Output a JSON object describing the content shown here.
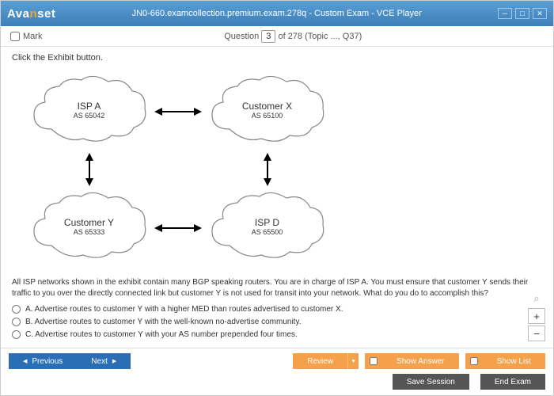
{
  "titlebar": {
    "logo_pre": "Ava",
    "logo_accent": "n",
    "logo_post": "set",
    "title": "JN0-660.examcollection.premium.exam.278q - Custom Exam - VCE Player"
  },
  "qbar": {
    "mark": "Mark",
    "qword": "Question",
    "num": "3",
    "rest": " of 278 (Topic ..., Q37)"
  },
  "instr": "Click the Exhibit button.",
  "clouds": {
    "tl": {
      "main": "ISP A",
      "sub": "AS 65042"
    },
    "tr": {
      "main": "Customer X",
      "sub": "AS 65100"
    },
    "bl": {
      "main": "Customer Y",
      "sub": "AS 65333"
    },
    "br": {
      "main": "ISP D",
      "sub": "AS 65500"
    }
  },
  "qtext": "All ISP networks shown in the exhibit contain many BGP speaking routers. You are in charge of ISP A. You must ensure that customer Y sends their traffic to you over the directly connected link but customer Y is not used for transit into your network. What do you do to accomplish this?",
  "opts": {
    "a": "A.  Advertise routes to customer Y with a higher MED than routes advertised to customer X.",
    "b": "B.  Advertise routes to customer Y with the well-known no-advertise community.",
    "c": "C.  Advertise routes to customer Y with your AS number prepended four times."
  },
  "buttons": {
    "prev": "Previous",
    "next": "Next",
    "review": "Review",
    "showans": "Show Answer",
    "showlist": "Show List",
    "savesession": "Save Session",
    "endexam": "End Exam"
  },
  "zoom": {
    "plus": "+",
    "minus": "−"
  }
}
